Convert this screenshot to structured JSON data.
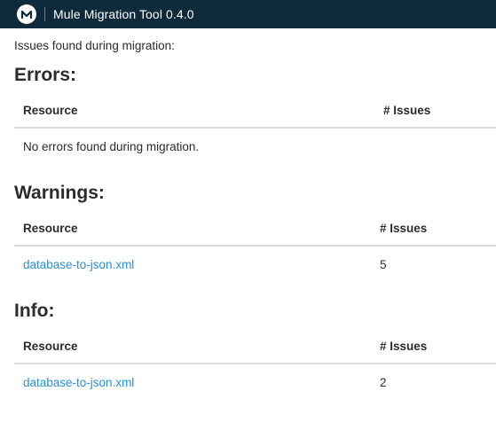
{
  "header": {
    "logo_icon": "mulesoft-logo-icon",
    "app_title": "Mule Migration Tool 0.4.0"
  },
  "intro_text": "Issues found during migration:",
  "errors": {
    "title": "Errors:",
    "columns": [
      "Resource",
      "# Issues"
    ],
    "empty_message": "No errors found during migration."
  },
  "warnings": {
    "title": "Warnings:",
    "columns": [
      "Resource",
      "# Issues"
    ],
    "rows": [
      {
        "resource": "database-to-json.xml",
        "issues": "5"
      }
    ]
  },
  "info": {
    "title": "Info:",
    "columns": [
      "Resource",
      "# Issues"
    ],
    "rows": [
      {
        "resource": "database-to-json.xml",
        "issues": "2"
      }
    ]
  },
  "colors": {
    "header_bg": "#0f2a3a",
    "link": "#2a8fcf"
  }
}
